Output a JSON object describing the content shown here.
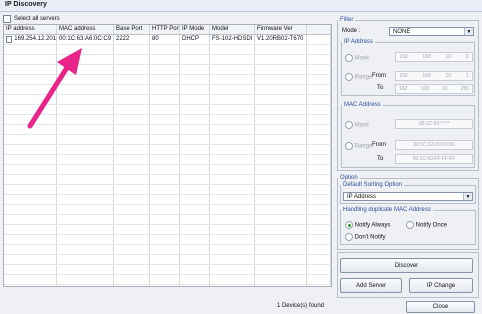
{
  "window": {
    "title": "IP Discovery"
  },
  "left": {
    "select_all_label": "Select all servers",
    "columns": [
      "IP address",
      "MAC address",
      "Base Port",
      "HTTP Port",
      "IP Mode",
      "Model",
      "Firmware Ver"
    ],
    "rows": [
      [
        "169.254.12.201",
        "00:1C:63:A6:0C:C9",
        "2222",
        "80",
        "DHCP",
        "FS-102-HDSDI",
        "V1.20RB02-T670"
      ]
    ],
    "status": "1  Device(s) found",
    "annotation_arrow_color": "#e8238a"
  },
  "filter": {
    "legend": "Filter",
    "mode_label": "Mode :",
    "mode_value": "NONE",
    "ip": {
      "legend": "IP Address",
      "mask_label": "Mask",
      "mask_value": [
        "192",
        "168",
        "10",
        "0"
      ],
      "range_label": "Range",
      "from_label": "From",
      "from_value": [
        "192",
        "168",
        "10",
        "1"
      ],
      "to_label": "To",
      "to_value": [
        "192",
        "168",
        "10",
        "255"
      ]
    },
    "mac": {
      "legend": "MAC Address",
      "mask_label": "Mask",
      "mask_value": "00:1C:63:*:*:*",
      "range_label": "Range",
      "from_label": "From",
      "from_value": "00:1C:63:00:00:00",
      "to_label": "To",
      "to_value": "00:1C:63:FF:FF:FF"
    }
  },
  "option": {
    "legend": "Option",
    "sort_legend": "Default Sorting Option",
    "sort_value": "IP Address",
    "dup_legend": "Handling duplicate MAC Address",
    "notify_always": "Notify Always",
    "notify_once": "Notify Once",
    "dont_notify": "Don't Notify"
  },
  "buttons": {
    "discover": "Discover",
    "add_server": "Add Server",
    "ip_change": "IP Change",
    "close": "Close"
  }
}
